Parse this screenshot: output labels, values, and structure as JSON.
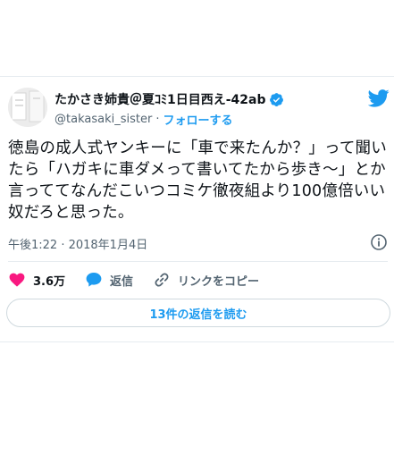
{
  "tweet": {
    "author_name": "たかさき姉貴＠夏ｺﾐ1日目西え-42ab",
    "handle": "@takasaki_sister",
    "separator": "·",
    "follow_label": "フォローする",
    "text": "徳島の成人式ヤンキーに「車で来たんか？」って聞いたら「ハガキに車ダメって書いてたから歩き〜」とか言っててなんだこいつコミケ徹夜組より100億倍いい奴だろと思った。",
    "timestamp": "午後1:22 · 2018年1月4日",
    "like_count": "3.6万",
    "reply_label": "返信",
    "copy_link_label": "リンクをコピー",
    "read_replies_label": "13件の返信を読む"
  },
  "colors": {
    "accent": "#1d9bf0",
    "like": "#f91880",
    "text": "#0f1419",
    "secondary": "#536471",
    "border": "#cfd9de"
  },
  "icons": {
    "brand": "twitter-bird-icon",
    "verified": "verified-badge-icon",
    "info": "info-icon",
    "like": "heart-icon",
    "reply": "speech-bubble-icon",
    "copy_link": "link-icon"
  }
}
